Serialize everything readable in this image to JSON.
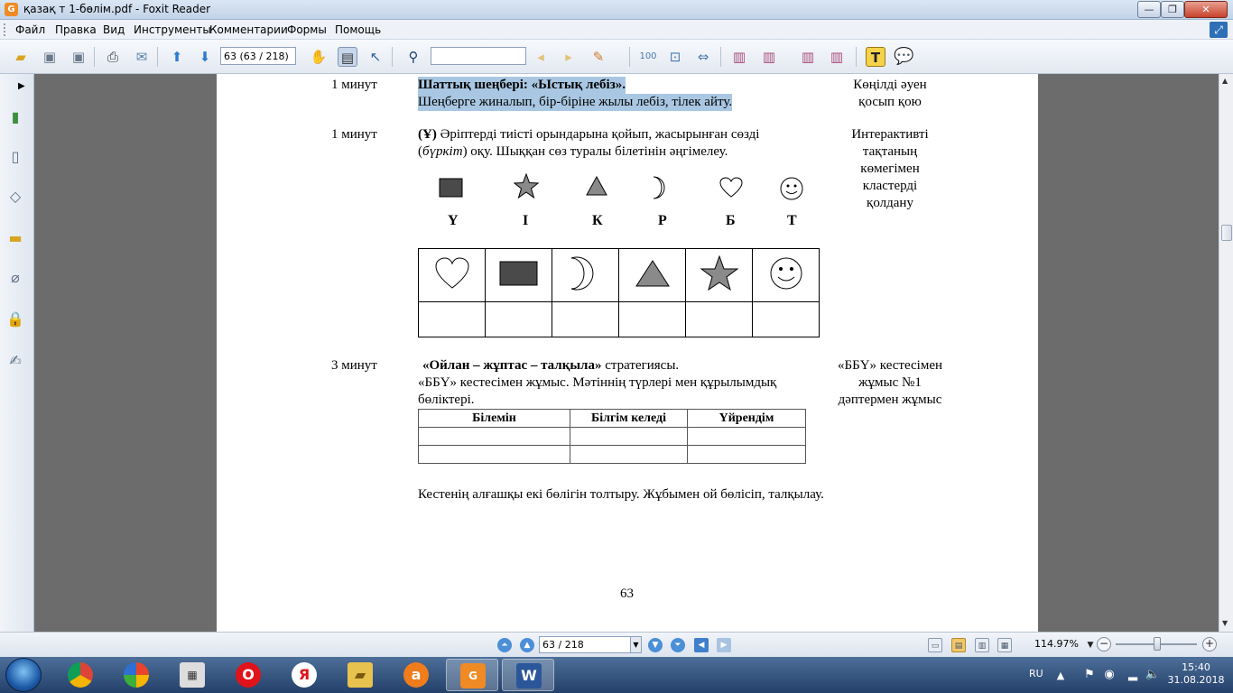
{
  "window": {
    "title": "қазақ т 1-бөлім.pdf - Foxit Reader",
    "app_icon": "foxit-icon",
    "buttons": {
      "minimize": "—",
      "maximize": "❐",
      "close": "✕"
    }
  },
  "menu": {
    "items": [
      "Файл",
      "Правка",
      "Вид",
      "Инструменты",
      "Комментарии",
      "Формы",
      "Помощь"
    ]
  },
  "toolbar": {
    "page_field": "63 (63 / 218)",
    "search_value": ""
  },
  "document": {
    "rows": [
      {
        "time": "1 минут",
        "title": "Шаттық шеңбері: «Ыстық лебіз».",
        "text": "Шеңберге жиналып, бір-біріне жылы лебіз, тілек айту.",
        "resource": "Көңілді әуен қосып қою"
      },
      {
        "time": "1 минут",
        "lead": "(Ұ)",
        "text1": " Әріптерді тиісті орындарына қойып, жасырынған сөзді",
        "text2a": "(",
        "text2b": "бүркіт",
        "text2c": ") оқу. Шыққан сөз туралы білетінін әңгімелеу.",
        "resource": "Интерактивті тақтаның көмегімен кластерді қолдану"
      },
      {
        "time": "3 минут",
        "strategy": "«Ойлан – жұптас – талқыла»",
        "strategy_suffix": " стратегиясы.",
        "text1": "«ББҮ» кестесімен жұмыс. Мәтіннің түрлері мен құрылымдық",
        "text2": "бөліктері.",
        "resource": "«ББҮ» кестесімен жұмыс №1 дәптермен жұмыс"
      }
    ],
    "symbols": [
      {
        "shape": "square",
        "letter": "Ү"
      },
      {
        "shape": "star",
        "letter": "І"
      },
      {
        "shape": "triangle",
        "letter": "К"
      },
      {
        "shape": "crescent",
        "letter": "Р"
      },
      {
        "shape": "heart",
        "letter": "Б"
      },
      {
        "shape": "smiley",
        "letter": "Т"
      }
    ],
    "answer_shapes": [
      "heart",
      "square",
      "crescent",
      "triangle",
      "star",
      "smiley"
    ],
    "bbu_table": {
      "headers": [
        "Білемін",
        "Білгім келеді",
        "Үйрендім"
      ],
      "rows": [
        [
          "",
          "",
          ""
        ],
        [
          "",
          "",
          ""
        ]
      ]
    },
    "bottom_text": "Кестенің алғашқы екі бөлігін толтыру. Жұбымен ой бөлісіп, талқылау.",
    "page_number": "63"
  },
  "statusbar": {
    "page_field": "63 / 218",
    "zoom": "114.97%",
    "zoom_level_fraction": 0.47
  },
  "taskbar": {
    "language": "RU",
    "time": "15:40",
    "date": "31.08.2018"
  },
  "colors": {
    "highlight": "#a9c7e2",
    "shape_fill": "#4a4a4a",
    "shape_gray": "#8a8a8a"
  }
}
